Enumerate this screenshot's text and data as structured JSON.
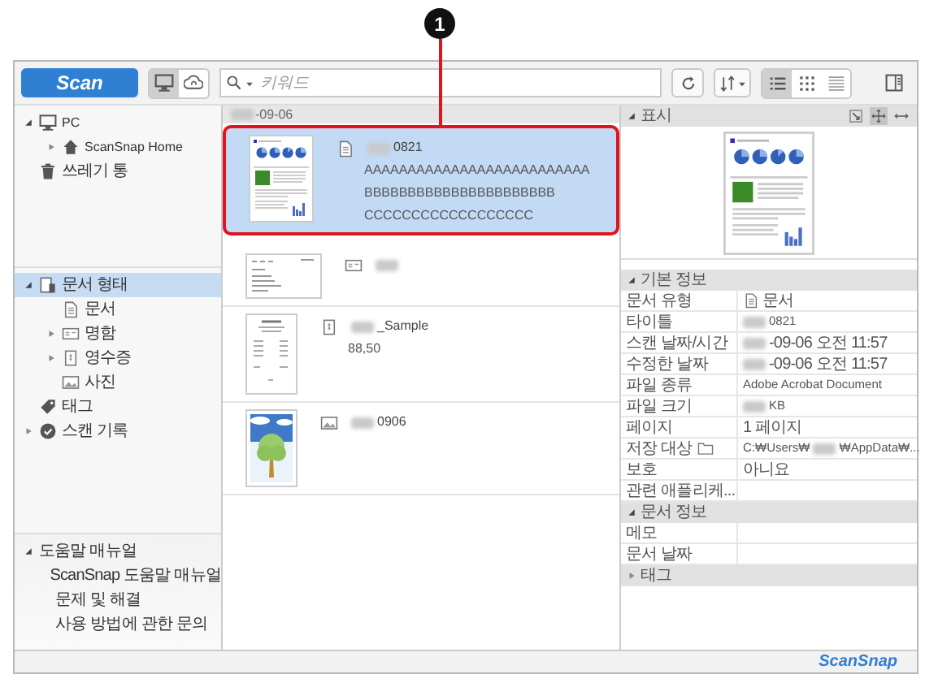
{
  "callout": {
    "number": "1"
  },
  "toolbar": {
    "scan_button": "Scan",
    "sources": [
      {
        "kind": "pc",
        "selected": true
      },
      {
        "kind": "cloud",
        "selected": false
      }
    ],
    "search": {
      "placeholder": "키워드"
    },
    "view_modes": [
      {
        "kind": "list",
        "selected": true
      },
      {
        "kind": "grid",
        "selected": false
      },
      {
        "kind": "detail",
        "selected": false
      }
    ],
    "panel_toggle": {
      "selected": false
    }
  },
  "sidebar": {
    "locations": [
      {
        "kind": "pc",
        "label": "PC",
        "expanded": true,
        "selected": false,
        "children": [
          {
            "kind": "home",
            "label": "ScanSnap Home",
            "expanded": false,
            "selected": false
          }
        ]
      },
      {
        "kind": "trash",
        "label": "쓰레기 통",
        "selected": false
      }
    ],
    "filters": [
      {
        "kind": "doctype",
        "label": "문서 형태",
        "expanded": true,
        "selected": true,
        "children": [
          {
            "kind": "document",
            "label": "문서",
            "selected": false
          },
          {
            "kind": "card",
            "label": "명함",
            "expanded": false,
            "selected": false
          },
          {
            "kind": "receipt",
            "label": "영수증",
            "expanded": false,
            "selected": false
          },
          {
            "label": "사진",
            "selected": false
          }
        ]
      },
      {
        "kind": "tag",
        "label": "태그",
        "selected": false
      },
      {
        "kind": "history",
        "label": "스캔 기록",
        "expanded": false,
        "selected": false
      }
    ],
    "help": [
      {
        "label": "도움말 매뉴얼",
        "expanded": true,
        "selected": false,
        "children": [
          {
            "label": "ScanSnap 도움말 매뉴얼",
            "selected": false
          },
          {
            "label": "문제 및 해결",
            "selected": false
          },
          {
            "label": "사용 방법에 관한 문의",
            "selected": false
          }
        ]
      }
    ]
  },
  "list": {
    "date_header": [
      {
        "kind": "blur"
      },
      {
        "kind": "text",
        "text": "-09-06"
      }
    ],
    "items": [
      {
        "kind": "document",
        "selected": true,
        "title": [
          {
            "kind": "blur"
          },
          {
            "kind": "text",
            "text": "0821"
          }
        ],
        "lines": [
          "AAAAAAAAAAAAAAAAAAAAAAAAAA",
          "BBBBBBBBBBBBBBBBBBBBBB",
          "CCCCCCCCCCCCCCCCCC"
        ]
      },
      {
        "kind": "card",
        "selected": false,
        "title": [
          {
            "kind": "blur"
          }
        ]
      },
      {
        "kind": "receipt",
        "selected": false,
        "title": [
          {
            "kind": "blur"
          },
          {
            "kind": "text",
            "text": "_Sample"
          }
        ],
        "lines": [
          "88,50"
        ]
      },
      {
        "selected": false,
        "title": [
          {
            "kind": "blur"
          },
          {
            "kind": "text",
            "text": "0906"
          }
        ]
      }
    ]
  },
  "details": {
    "preview": {
      "title": "표시",
      "tools": [
        {
          "kind": "fit",
          "selected": false
        },
        {
          "kind": "move",
          "selected": true
        },
        {
          "kind": "width",
          "selected": false
        }
      ]
    },
    "sections": [
      {
        "title": "기본 정보",
        "expanded": true,
        "rows": [
          {
            "label": "문서 유형",
            "kind": "document",
            "value": [
              {
                "kind": "text",
                "text": "문서"
              }
            ]
          },
          {
            "label": "타이틀",
            "value": [
              {
                "kind": "blur"
              },
              {
                "kind": "text",
                "text": "0821"
              }
            ]
          },
          {
            "label": "스캔 날짜/시간",
            "value": [
              {
                "kind": "blur"
              },
              {
                "kind": "text",
                "text": "-09-06 오전 11:57"
              }
            ]
          },
          {
            "label": "수정한 날짜",
            "value": [
              {
                "kind": "blur"
              },
              {
                "kind": "text",
                "text": "-09-06 오전 11:57"
              }
            ]
          },
          {
            "label": "파일 종류",
            "value": [
              {
                "kind": "text",
                "text": "Adobe Acrobat Document"
              }
            ]
          },
          {
            "label": "파일 크기",
            "value": [
              {
                "kind": "blur"
              },
              {
                "kind": "text",
                "text": "KB"
              }
            ]
          },
          {
            "label": "페이지",
            "value": [
              {
                "kind": "text",
                "text": "1 페이지"
              }
            ]
          },
          {
            "label": "저장 대상",
            "kind": "location",
            "value": [
              {
                "kind": "text",
                "text": "C:₩Users₩"
              },
              {
                "kind": "blur"
              },
              {
                "kind": "text",
                "text": "₩AppData₩..."
              }
            ]
          },
          {
            "label": "보호",
            "value": [
              {
                "kind": "text",
                "text": "아니요"
              }
            ]
          },
          {
            "label": "관련 애플리케...",
            "value": []
          }
        ]
      },
      {
        "title": "문서 정보",
        "expanded": true,
        "rows": [
          {
            "label": "메모",
            "value": []
          },
          {
            "label": "문서 날짜",
            "value": []
          }
        ]
      },
      {
        "title": "태그",
        "expanded": false
      }
    ]
  },
  "footer": {
    "logo": "ScanSnap"
  }
}
